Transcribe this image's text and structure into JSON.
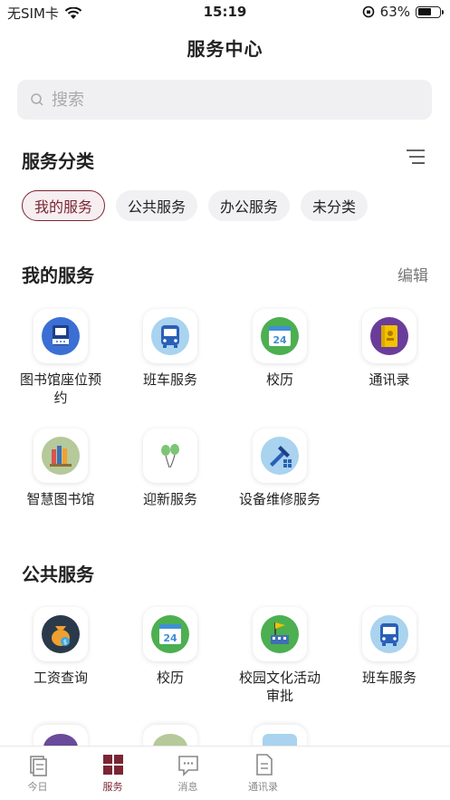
{
  "status": {
    "carrier": "无SIM卡",
    "time": "15:19",
    "battery": "63%",
    "battery_level": 0.63
  },
  "page_title": "服务中心",
  "search": {
    "placeholder": "搜索"
  },
  "category": {
    "title": "服务分类",
    "chips": [
      "我的服务",
      "公共服务",
      "办公服务",
      "未分类"
    ],
    "active": "我的服务"
  },
  "my_services": {
    "title": "我的服务",
    "edit_label": "编辑",
    "items": [
      {
        "label": "图书馆座位预约",
        "icon": "library-seat-icon"
      },
      {
        "label": "班车服务",
        "icon": "bus-icon"
      },
      {
        "label": "校历",
        "icon": "calendar-24-icon"
      },
      {
        "label": "通讯录",
        "icon": "contacts-book-icon"
      },
      {
        "label": "智慧图书馆",
        "icon": "books-icon"
      },
      {
        "label": "迎新服务",
        "icon": "balloons-icon"
      },
      {
        "label": "设备维修服务",
        "icon": "repair-tools-icon"
      }
    ]
  },
  "public_services": {
    "title": "公共服务",
    "items": [
      {
        "label": "工资查询",
        "icon": "money-bag-icon"
      },
      {
        "label": "校历",
        "icon": "calendar-24-icon"
      },
      {
        "label": "校园文化活动审批",
        "icon": "flag-building-icon"
      },
      {
        "label": "班车服务",
        "icon": "bus-icon"
      }
    ]
  },
  "tabbar": {
    "items": [
      {
        "label": "今日",
        "icon": "today-icon"
      },
      {
        "label": "服务",
        "icon": "services-grid-icon"
      },
      {
        "label": "消息",
        "icon": "message-icon"
      },
      {
        "label": "通讯录",
        "icon": "contacts-icon"
      }
    ],
    "active": "服务"
  },
  "colors": {
    "accent": "#7a2634",
    "chip_bg": "#f1f1f3",
    "search_bg": "#f0f0f2"
  }
}
